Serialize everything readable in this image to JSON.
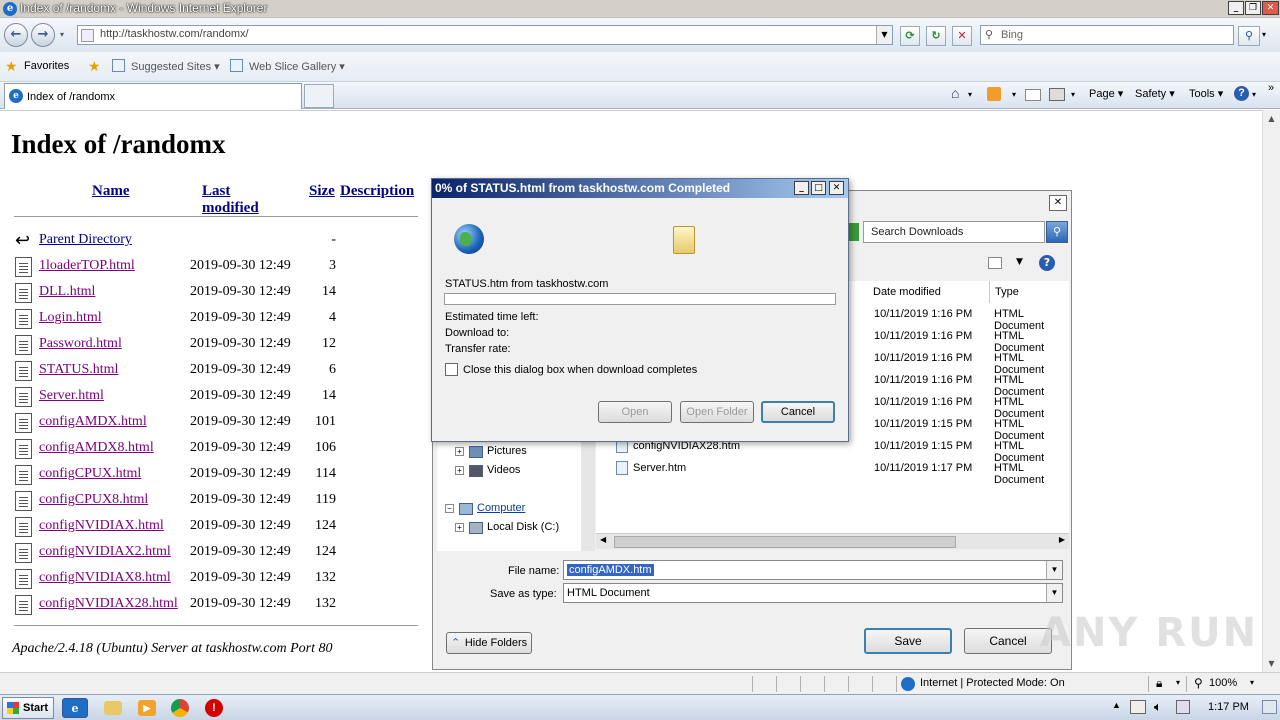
{
  "window": {
    "title": "Index of /randomx - Windows Internet Explorer",
    "address": "http://taskhostw.com/randomx/",
    "search_placeholder": "Bing"
  },
  "favorites_bar": {
    "favorites": "Favorites",
    "suggested": "Suggested Sites ▾",
    "webslice": "Web Slice Gallery ▾"
  },
  "tab": {
    "title": "Index of /randomx"
  },
  "command_bar": {
    "page": "Page ▾",
    "safety": "Safety ▾",
    "tools": "Tools ▾"
  },
  "page": {
    "heading": "Index of /randomx",
    "columns": {
      "name": "Name",
      "modified": "Last modified",
      "size": "Size",
      "description": "Description"
    },
    "parent": {
      "name": "Parent Directory",
      "size": "-"
    },
    "files": [
      {
        "name": "1loaderTOP.html",
        "date": "2019-09-30 12:49",
        "size": "3"
      },
      {
        "name": "DLL.html",
        "date": "2019-09-30 12:49",
        "size": "14"
      },
      {
        "name": "Login.html",
        "date": "2019-09-30 12:49",
        "size": "4"
      },
      {
        "name": "Password.html",
        "date": "2019-09-30 12:49",
        "size": "12"
      },
      {
        "name": "STATUS.html",
        "date": "2019-09-30 12:49",
        "size": "6"
      },
      {
        "name": "Server.html",
        "date": "2019-09-30 12:49",
        "size": "14"
      },
      {
        "name": "configAMDX.html",
        "date": "2019-09-30 12:49",
        "size": "101"
      },
      {
        "name": "configAMDX8.html",
        "date": "2019-09-30 12:49",
        "size": "106"
      },
      {
        "name": "configCPUX.html",
        "date": "2019-09-30 12:49",
        "size": "114"
      },
      {
        "name": "configCPUX8.html",
        "date": "2019-09-30 12:49",
        "size": "119"
      },
      {
        "name": "configNVIDIAX.html",
        "date": "2019-09-30 12:49",
        "size": "124"
      },
      {
        "name": "configNVIDIAX2.html",
        "date": "2019-09-30 12:49",
        "size": "124"
      },
      {
        "name": "configNVIDIAX8.html",
        "date": "2019-09-30 12:49",
        "size": "132"
      },
      {
        "name": "configNVIDIAX28.html",
        "date": "2019-09-30 12:49",
        "size": "132"
      }
    ],
    "footer": "Apache/2.4.18 (Ubuntu) Server at taskhostw.com Port 80"
  },
  "download_dialog": {
    "title": "0% of STATUS.html from taskhostw.com Completed",
    "source": "STATUS.htm from taskhostw.com",
    "progress": 0,
    "est_time": "Estimated time left:",
    "download_to": "Download to:",
    "transfer_rate": "Transfer rate:",
    "close_checkbox": "Close this dialog box when download completes",
    "open": "Open",
    "open_folder": "Open Folder",
    "cancel": "Cancel"
  },
  "save_dialog": {
    "search_placeholder": "Search Downloads",
    "col_date": "Date modified",
    "col_type": "Type",
    "files": [
      {
        "name": "",
        "date": "10/11/2019 1:16 PM",
        "type": "HTML Document"
      },
      {
        "name": "",
        "date": "10/11/2019 1:16 PM",
        "type": "HTML Document"
      },
      {
        "name": "",
        "date": "10/11/2019 1:16 PM",
        "type": "HTML Document"
      },
      {
        "name": "",
        "date": "10/11/2019 1:16 PM",
        "type": "HTML Document"
      },
      {
        "name": "",
        "date": "10/11/2019 1:16 PM",
        "type": "HTML Document"
      },
      {
        "name": "",
        "date": "10/11/2019 1:15 PM",
        "type": "HTML Document"
      },
      {
        "name": "configNVIDIAX28.htm",
        "date": "10/11/2019 1:15 PM",
        "type": "HTML Document"
      },
      {
        "name": "Server.htm",
        "date": "10/11/2019 1:17 PM",
        "type": "HTML Document"
      }
    ],
    "tree": {
      "pictures": "Pictures",
      "videos": "Videos",
      "computer": "Computer",
      "local_disk": "Local Disk (C:)"
    },
    "file_name_label": "File name:",
    "file_name": "configAMDX.htm",
    "save_type_label": "Save as type:",
    "save_type": "HTML Document",
    "hide_folders": "Hide Folders",
    "save": "Save",
    "cancel": "Cancel"
  },
  "status_bar": {
    "zone": "Internet | Protected Mode: On",
    "zoom": "100%"
  },
  "taskbar": {
    "start": "Start",
    "time": "1:17 PM"
  },
  "watermark": "ANY RUN"
}
